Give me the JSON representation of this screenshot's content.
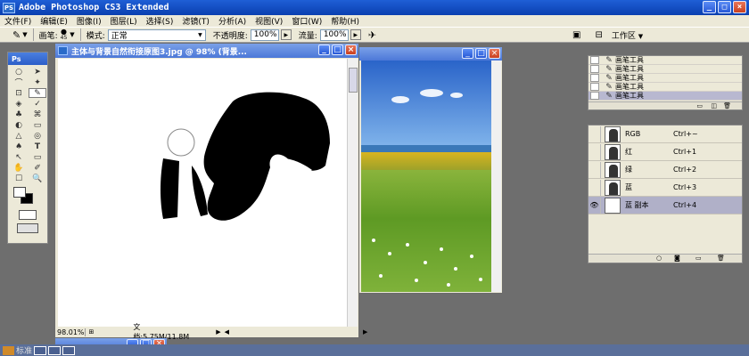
{
  "app": {
    "title": "Adobe Photoshop CS3 Extended",
    "logo": "PS",
    "window_buttons": [
      "_",
      "□",
      "×"
    ]
  },
  "menubar": [
    "文件(F)",
    "编辑(E)",
    "图像(I)",
    "图层(L)",
    "选择(S)",
    "滤镜(T)",
    "分析(A)",
    "视图(V)",
    "窗口(W)",
    "帮助(H)"
  ],
  "options_bar": {
    "brush_label": "画笔:",
    "brush_size": "45",
    "mode_label": "模式:",
    "mode_value": "正常",
    "opacity_label": "不透明度:",
    "opacity_value": "100%",
    "flow_label": "流量:",
    "flow_value": "100%",
    "workspace_label": "工作区"
  },
  "toolbox": {
    "header": "Ps",
    "tools": [
      "○",
      "➤",
      "⌒",
      "✦",
      "⊡",
      "✎",
      "◈",
      "✓",
      "♣",
      "⌘",
      "◐",
      "▭",
      "△",
      "◎",
      "♠",
      "T",
      "↖",
      "▭",
      "✋",
      "✐",
      "☐",
      "🔍"
    ]
  },
  "document": {
    "title": "主体与背景自然衔接原图3.jpg @ 98% (背景...",
    "zoom": "98.01%",
    "doc_size": "文档:5.75M/11.8M"
  },
  "history_panel": {
    "items": [
      "画笔工具",
      "画笔工具",
      "画笔工具",
      "画笔工具",
      "画笔工具"
    ],
    "selected_index": 4
  },
  "channels_panel": {
    "channels": [
      {
        "name": "RGB",
        "shortcut": "Ctrl+~",
        "visible": false
      },
      {
        "name": "红",
        "shortcut": "Ctrl+1",
        "visible": false
      },
      {
        "name": "绿",
        "shortcut": "Ctrl+2",
        "visible": false
      },
      {
        "name": "蓝",
        "shortcut": "Ctrl+3",
        "visible": false
      },
      {
        "name": "蓝 副本",
        "shortcut": "Ctrl+4",
        "visible": true
      }
    ],
    "selected_index": 4
  },
  "taskbar": {
    "label": "标准"
  },
  "colors": {
    "title_blue": "#0a3fb0",
    "chrome": "#ece9d8",
    "workspace_gray": "#6e6e6e",
    "close_red": "#c9401f"
  }
}
